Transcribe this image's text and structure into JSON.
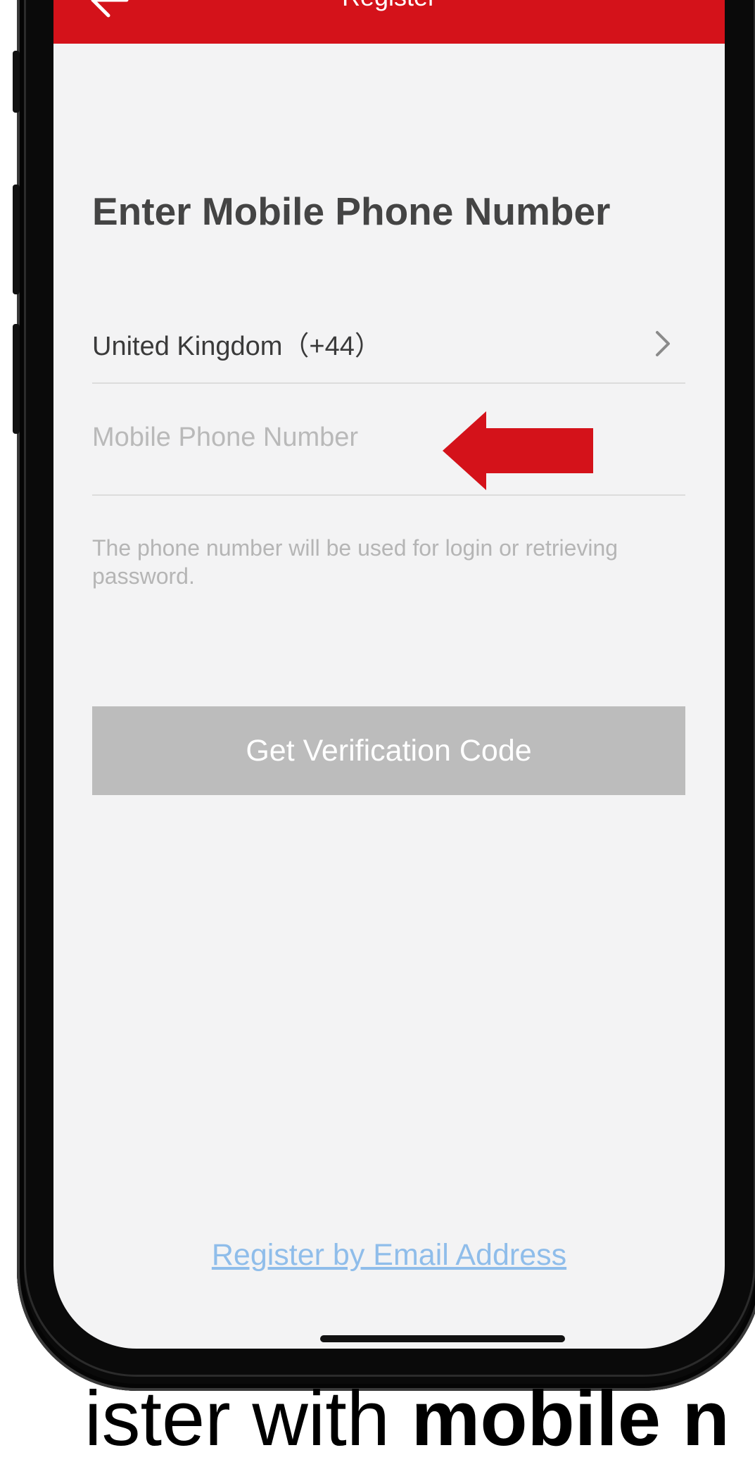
{
  "nav": {
    "title": "Register",
    "back_icon": "back-arrow-icon",
    "color": "#d4121a"
  },
  "page": {
    "heading": "Enter Mobile Phone Number"
  },
  "country": {
    "label": "United Kingdom（+44）",
    "icon": "chevron-right-icon"
  },
  "phone": {
    "value": "",
    "placeholder": "Mobile Phone Number",
    "annotation_icon": "red-arrow-icon",
    "annotation_color": "#d4121a"
  },
  "hint": {
    "text": "The phone number will be used for login or retrieving password."
  },
  "actions": {
    "verify_label": "Get Verification Code",
    "verify_color": "#bcbcbc",
    "email_link_label": "Register by Email Address",
    "email_link_color": "#8fbdea"
  },
  "caption": {
    "prefix": "ister with",
    "bold": "mobile n"
  }
}
